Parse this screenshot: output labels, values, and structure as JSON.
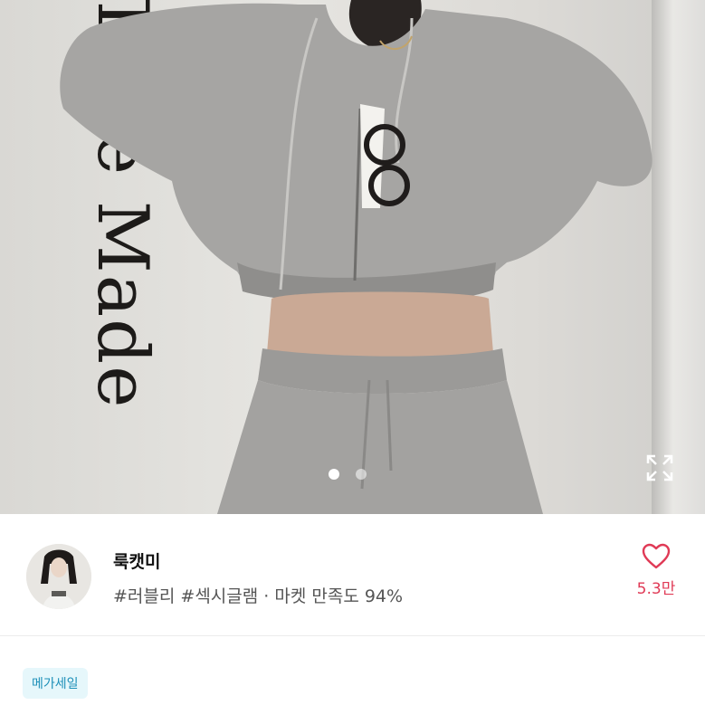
{
  "hero": {
    "background_text": "Time Made",
    "pager": {
      "total": 2,
      "active": 1
    },
    "expand_icon": "expand-icon"
  },
  "seller": {
    "name": "룩캣미",
    "tags": "#러블리 #섹시글램 · 마켓 만족도 94%",
    "like_icon": "heart-outline-icon",
    "like_count": "5.3만"
  },
  "badge": {
    "label": "메가세일"
  },
  "colors": {
    "like": "#e03a56",
    "badge_text": "#1c8fb8",
    "badge_bg": "#e6f7fb"
  }
}
